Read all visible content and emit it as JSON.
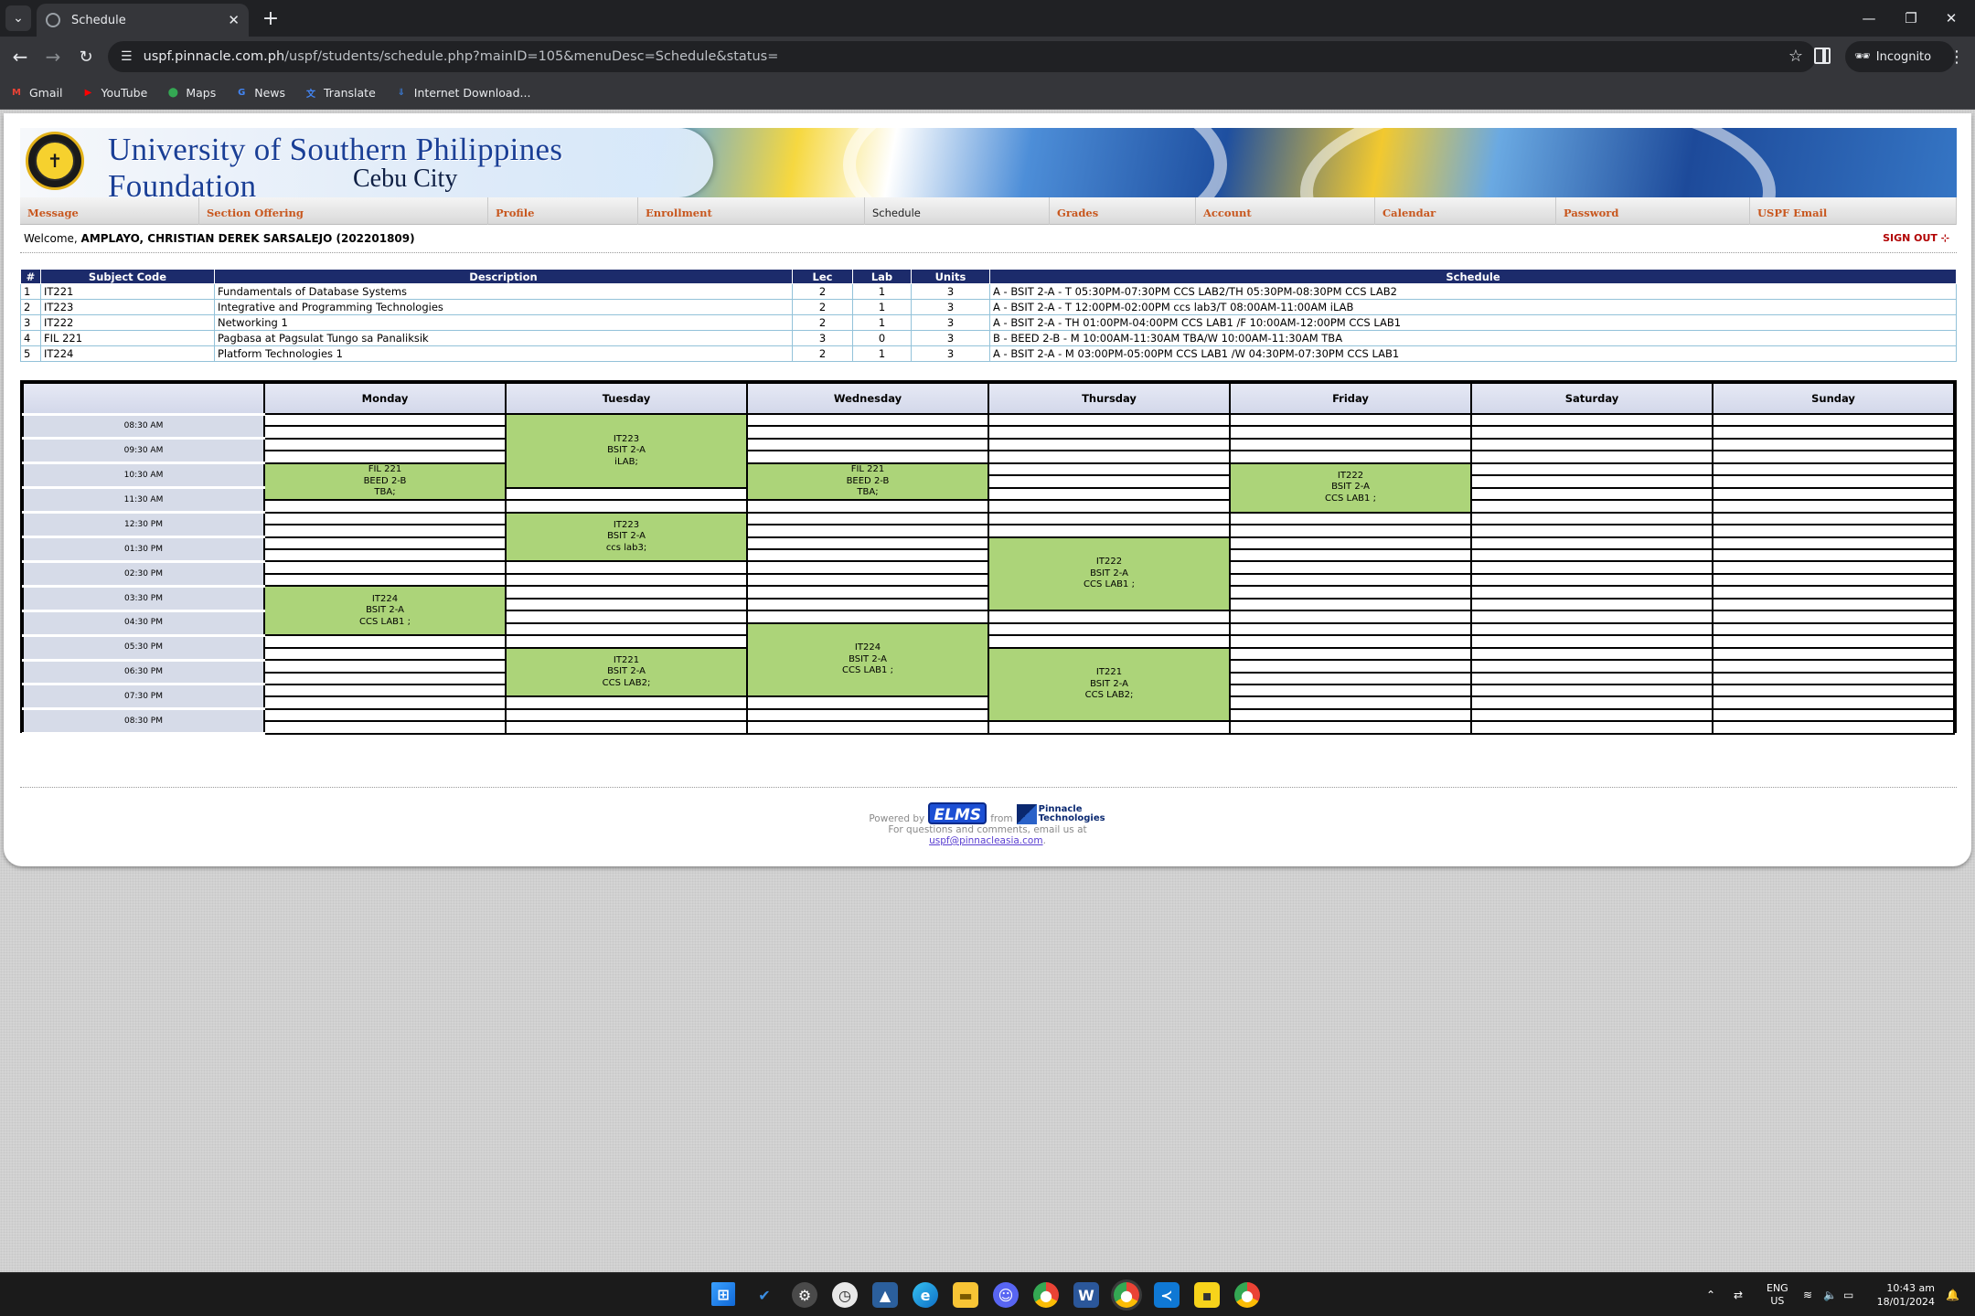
{
  "browser": {
    "tab_title": "Schedule",
    "url_host": "uspf.pinnacle.com.ph",
    "url_path": "/uspf/students/schedule.php?mainID=105&menuDesc=Schedule&status=",
    "incognito_label": "Incognito",
    "bookmarks": [
      {
        "label": "Gmail",
        "icon": "gmail-icon",
        "color": "#ea4335",
        "glyph": "M"
      },
      {
        "label": "YouTube",
        "icon": "youtube-icon",
        "color": "#ff0000",
        "glyph": "▶"
      },
      {
        "label": "Maps",
        "icon": "maps-icon",
        "color": "#34a853",
        "glyph": "⬤"
      },
      {
        "label": "News",
        "icon": "news-icon",
        "color": "#4285f4",
        "glyph": "G"
      },
      {
        "label": "Translate",
        "icon": "translate-icon",
        "color": "#4285f4",
        "glyph": "文"
      },
      {
        "label": "Internet Download...",
        "icon": "idm-icon",
        "color": "#3a7bd5",
        "glyph": "⇓"
      }
    ]
  },
  "header": {
    "university_name": "University of Southern Philippines Foundation",
    "city": "Cebu City"
  },
  "menu": [
    {
      "label": "Message",
      "active": false
    },
    {
      "label": "Section Offering",
      "active": false
    },
    {
      "label": "Profile",
      "active": false
    },
    {
      "label": "Enrollment",
      "active": false
    },
    {
      "label": "Schedule",
      "active": true
    },
    {
      "label": "Grades",
      "active": false
    },
    {
      "label": "Account",
      "active": false
    },
    {
      "label": "Calendar",
      "active": false
    },
    {
      "label": "Password",
      "active": false
    },
    {
      "label": "USPF Email",
      "active": false
    }
  ],
  "welcome": {
    "prefix": "Welcome, ",
    "student": "AMPLAYO, CHRISTIAN DEREK SARSALEJO (202201809)",
    "sign_out": "SIGN OUT"
  },
  "subjects_table": {
    "headers": [
      "#",
      "Subject Code",
      "Description",
      "Lec",
      "Lab",
      "Units",
      "Schedule"
    ],
    "rows": [
      [
        "1",
        "IT221",
        "Fundamentals of Database Systems",
        "2",
        "1",
        "3",
        "A - BSIT 2-A - T 05:30PM-07:30PM CCS LAB2/TH 05:30PM-08:30PM CCS LAB2"
      ],
      [
        "2",
        "IT223",
        "Integrative and Programming Technologies",
        "2",
        "1",
        "3",
        "A - BSIT 2-A - T 12:00PM-02:00PM ccs lab3/T 08:00AM-11:00AM iLAB"
      ],
      [
        "3",
        "IT222",
        "Networking 1",
        "2",
        "1",
        "3",
        "A - BSIT 2-A - TH 01:00PM-04:00PM CCS LAB1 /F 10:00AM-12:00PM CCS LAB1"
      ],
      [
        "4",
        "FIL 221",
        "Pagbasa at Pagsulat Tungo sa Panaliksik",
        "3",
        "0",
        "3",
        "B - BEED 2-B - M 10:00AM-11:30AM TBA/W 10:00AM-11:30AM TBA"
      ],
      [
        "5",
        "IT224",
        "Platform Technologies 1",
        "2",
        "1",
        "3",
        "A - BSIT 2-A - M 03:00PM-05:00PM CCS LAB1 /W 04:30PM-07:30PM CCS LAB1"
      ]
    ]
  },
  "weekly_grid": {
    "days": [
      "Monday",
      "Tuesday",
      "Wednesday",
      "Thursday",
      "Friday",
      "Saturday",
      "Sunday"
    ],
    "slot_labels": [
      "08:30 AM",
      "09:30 AM",
      "10:30 AM",
      "11:30 AM",
      "12:30 PM",
      "01:30 PM",
      "02:30 PM",
      "03:30 PM",
      "04:30 PM",
      "05:30 PM",
      "06:30 PM",
      "07:30 PM",
      "08:30 PM"
    ],
    "slots_per_label": 2,
    "blocks": [
      {
        "day": 0,
        "start": 4,
        "span": 3,
        "lines": [
          "FIL 221",
          "BEED 2-B",
          "TBA;"
        ]
      },
      {
        "day": 0,
        "start": 14,
        "span": 4,
        "lines": [
          "IT224",
          "BSIT 2-A",
          "CCS LAB1 ;"
        ]
      },
      {
        "day": 1,
        "start": 0,
        "span": 6,
        "lines": [
          "IT223",
          "BSIT 2-A",
          "iLAB;"
        ]
      },
      {
        "day": 1,
        "start": 8,
        "span": 4,
        "lines": [
          "IT223",
          "BSIT 2-A",
          "ccs lab3;"
        ]
      },
      {
        "day": 1,
        "start": 19,
        "span": 4,
        "lines": [
          "IT221",
          "BSIT 2-A",
          "CCS LAB2;"
        ]
      },
      {
        "day": 2,
        "start": 4,
        "span": 3,
        "lines": [
          "FIL 221",
          "BEED 2-B",
          "TBA;"
        ]
      },
      {
        "day": 2,
        "start": 17,
        "span": 6,
        "lines": [
          "IT224",
          "BSIT 2-A",
          "CCS LAB1 ;"
        ]
      },
      {
        "day": 3,
        "start": 10,
        "span": 6,
        "lines": [
          "IT222",
          "BSIT 2-A",
          "CCS LAB1 ;"
        ]
      },
      {
        "day": 3,
        "start": 19,
        "span": 6,
        "lines": [
          "IT221",
          "BSIT 2-A",
          "CCS LAB2;"
        ]
      },
      {
        "day": 4,
        "start": 4,
        "span": 4,
        "lines": [
          "IT222",
          "BSIT 2-A",
          "CCS LAB1 ;"
        ]
      }
    ],
    "block_color": "#acd479"
  },
  "footer": {
    "powered_by": "Powered by",
    "elms_logo": "ELMS",
    "from": "from",
    "pinnacle_logo": "Pinnacle Technologies",
    "questions": "For questions and comments, email us at",
    "email": "uspf@pinnacleasia.com",
    "email_suffix": "."
  },
  "taskbar": {
    "lang_top": "ENG",
    "lang_bottom": "US",
    "time": "10:43 am",
    "date": "18/01/2024"
  }
}
